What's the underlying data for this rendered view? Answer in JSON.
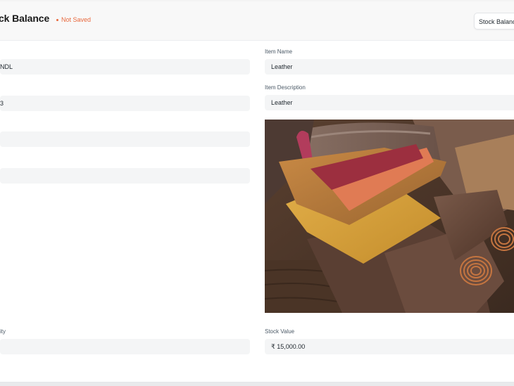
{
  "header": {
    "title": "ck Balance",
    "status": "Not Saved",
    "stock_button": "Stock Balance"
  },
  "left_fields": [
    {
      "label": "",
      "value": "NDL"
    },
    {
      "label": "",
      "value": "3"
    },
    {
      "label": "",
      "value": ""
    },
    {
      "label": "",
      "value": ""
    }
  ],
  "right_fields": {
    "item_name": {
      "label": "Item Name",
      "value": "Leather"
    },
    "item_description": {
      "label": "Item Description",
      "value": "Leather"
    }
  },
  "bottom_fields": {
    "quantity": {
      "label": "ity",
      "value": ""
    },
    "stock_value": {
      "label": "Stock Value",
      "value": "₹ 15,000.00"
    }
  },
  "image": {
    "subject": "leather-swatches-photo"
  },
  "colors": {
    "status": "#e8683d",
    "input_bg": "#f4f5f6"
  }
}
